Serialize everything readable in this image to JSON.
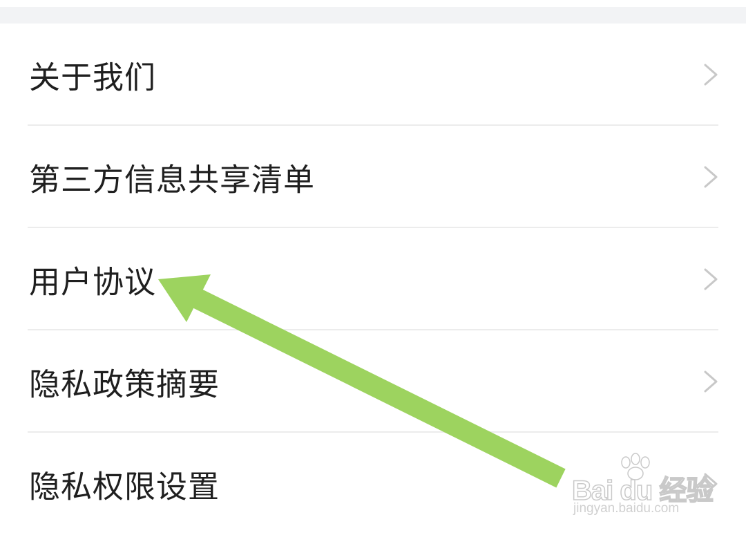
{
  "menu": {
    "items": [
      {
        "label": "关于我们"
      },
      {
        "label": "第三方信息共享清单"
      },
      {
        "label": "用户协议"
      },
      {
        "label": "隐私政策摘要"
      },
      {
        "label": "隐私权限设置"
      }
    ]
  },
  "annotation": {
    "arrow_color": "#9dd35f",
    "arrow_icon": "green-pointer-arrow"
  },
  "watermark": {
    "logo_text": "Bai du 经验",
    "url": "jingyan.baidu.com"
  },
  "colors": {
    "background": "#ffffff",
    "top_gap": "#f2f3f5",
    "divider": "#ececec",
    "text": "#1f1f1f",
    "chevron": "#c8c8c8"
  }
}
